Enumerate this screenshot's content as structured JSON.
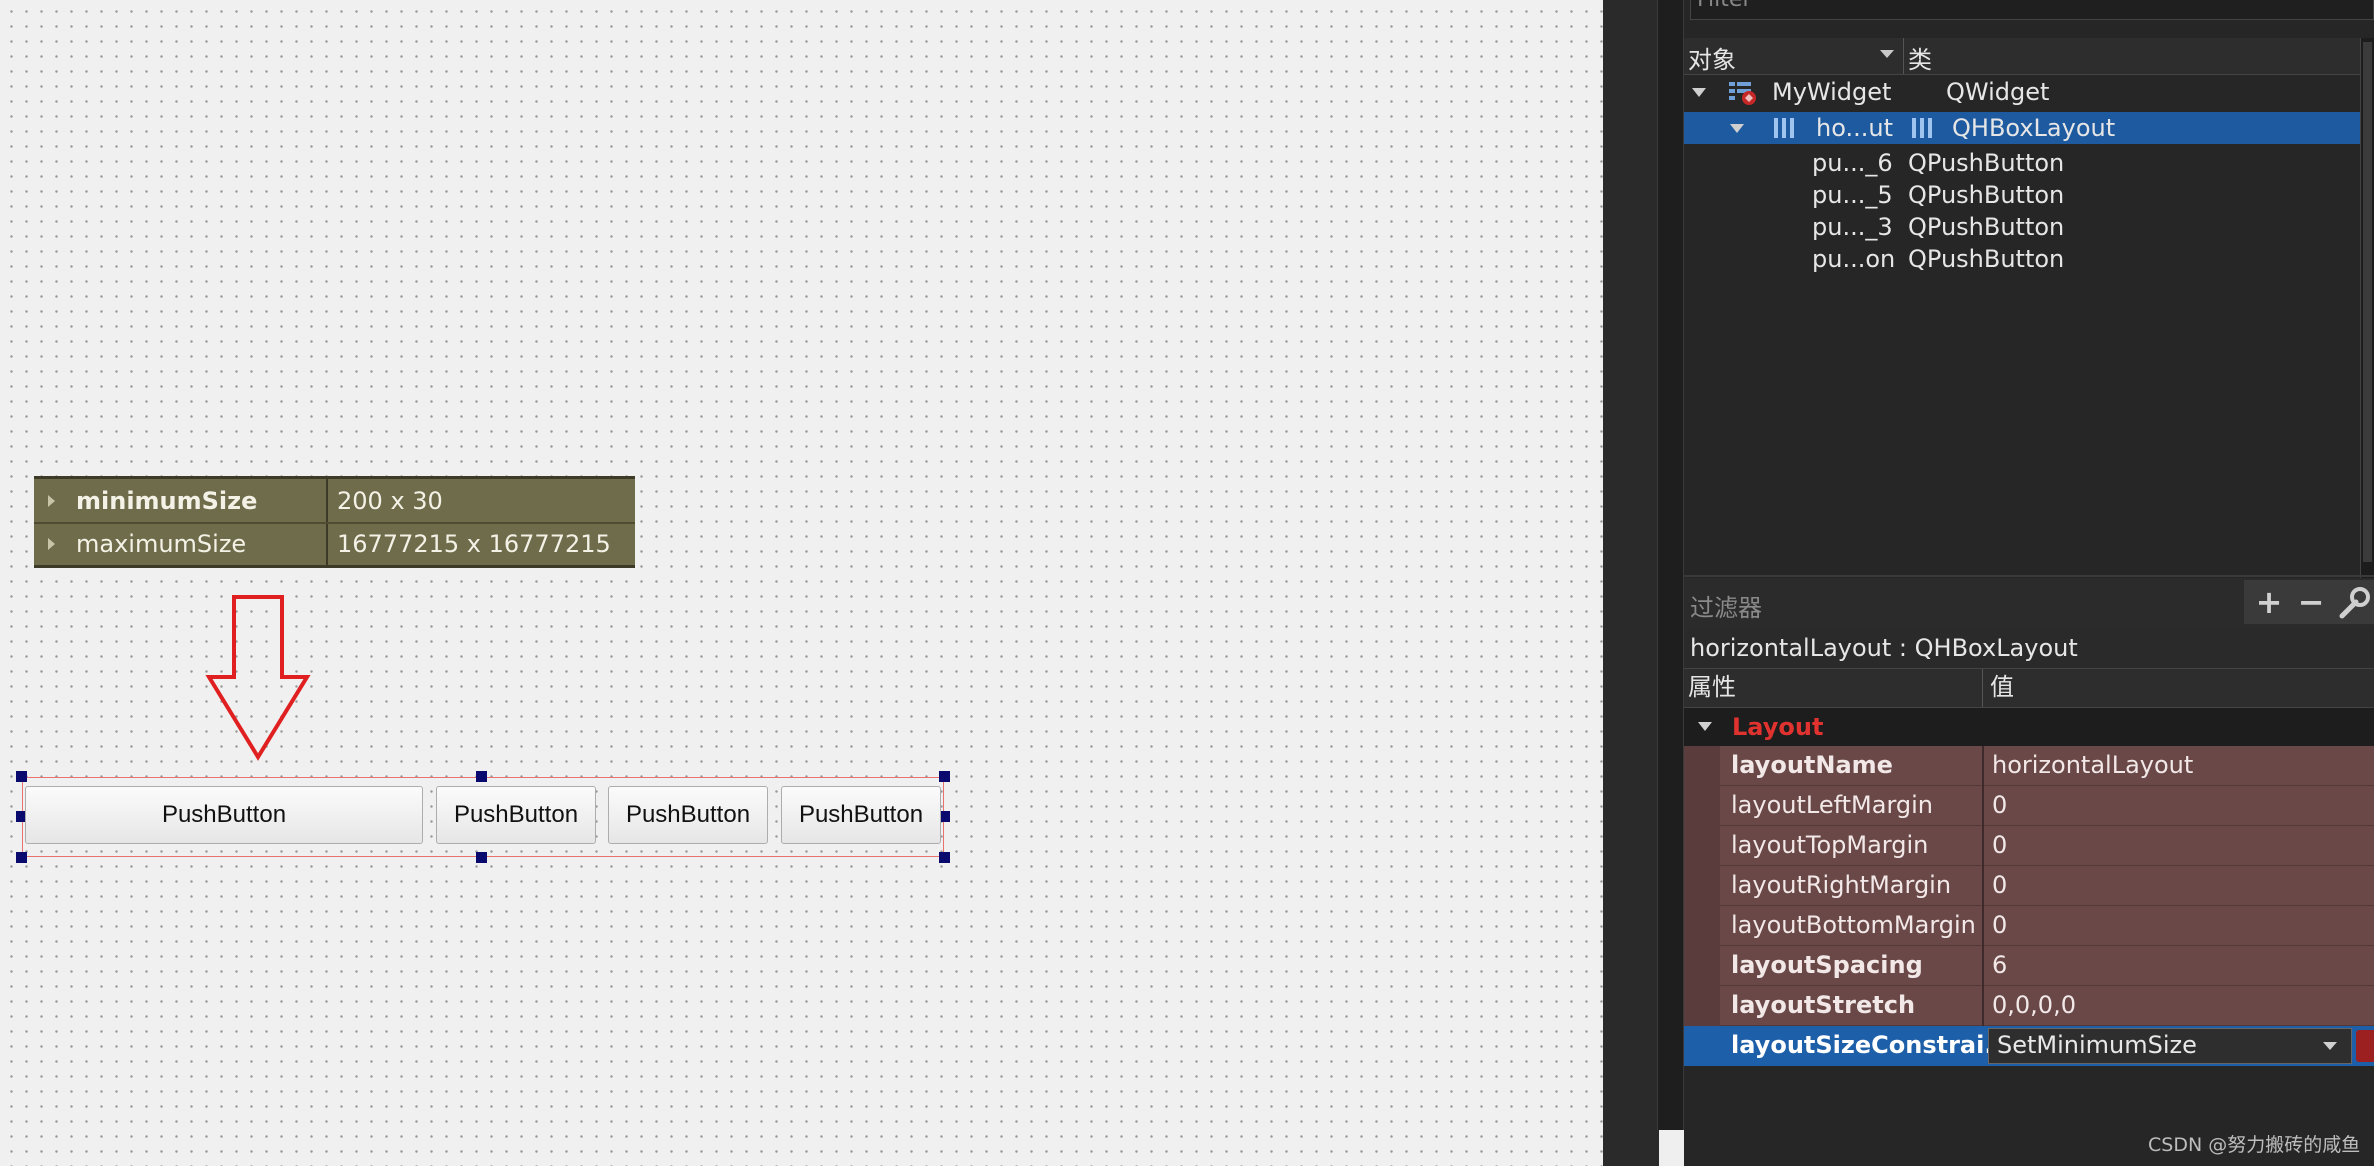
{
  "snippet": {
    "rows": [
      {
        "name": "minimumSize",
        "value": "200 x 30"
      },
      {
        "name": "maximumSize",
        "value": "16777215 x 16777215"
      }
    ]
  },
  "form": {
    "buttons": [
      "PushButton",
      "PushButton",
      "PushButton",
      "PushButton"
    ]
  },
  "object_inspector": {
    "filter_placeholder": "Filter",
    "col_object": "对象",
    "col_class": "类",
    "rows": [
      {
        "name": "MyWidget",
        "class": "QWidget"
      },
      {
        "name": "ho...ut",
        "class": "QHBoxLayout"
      },
      {
        "name": "pu..._6",
        "class": "QPushButton"
      },
      {
        "name": "pu..._5",
        "class": "QPushButton"
      },
      {
        "name": "pu..._3",
        "class": "QPushButton"
      },
      {
        "name": "pu...on",
        "class": "QPushButton"
      }
    ]
  },
  "property_editor": {
    "filter_placeholder": "过滤器",
    "object_title": "horizontalLayout : QHBoxLayout",
    "col_property": "属性",
    "col_value": "值",
    "group": "Layout",
    "rows": [
      {
        "name": "layoutName",
        "value": "horizontalLayout"
      },
      {
        "name": "layoutLeftMargin",
        "value": "0"
      },
      {
        "name": "layoutTopMargin",
        "value": "0"
      },
      {
        "name": "layoutRightMargin",
        "value": "0"
      },
      {
        "name": "layoutBottomMargin",
        "value": "0"
      },
      {
        "name": "layoutSpacing",
        "value": "6"
      },
      {
        "name": "layoutStretch",
        "value": "0,0,0,0"
      }
    ],
    "selected": {
      "name": "layoutSizeConstrai...",
      "value": "SetMinimumSize"
    }
  },
  "watermark": "CSDN @努力搬砖的咸鱼",
  "colors": {
    "annotation_arrow": "#e02020",
    "group_label": "#e0332f",
    "selection": "#1e5aa0",
    "property_row": "#6a4848"
  }
}
